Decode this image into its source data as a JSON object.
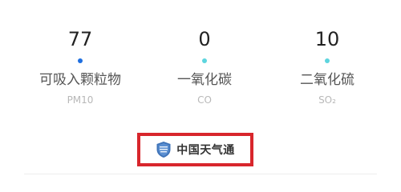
{
  "air_quality": {
    "items": [
      {
        "value": "77",
        "name": "可吸入颗粒物",
        "code": "PM10",
        "dot_color": "#1f6fe0"
      },
      {
        "value": "0",
        "name": "一氧化碳",
        "code": "CO",
        "dot_color": "#5dd5de"
      },
      {
        "value": "10",
        "name": "二氧化硫",
        "code": "SO₂",
        "dot_color": "#5dd5de"
      }
    ]
  },
  "source": {
    "logo_icon": "weather-shield-logo-icon",
    "label": "中国天气通",
    "highlight_color": "#d8262c"
  }
}
